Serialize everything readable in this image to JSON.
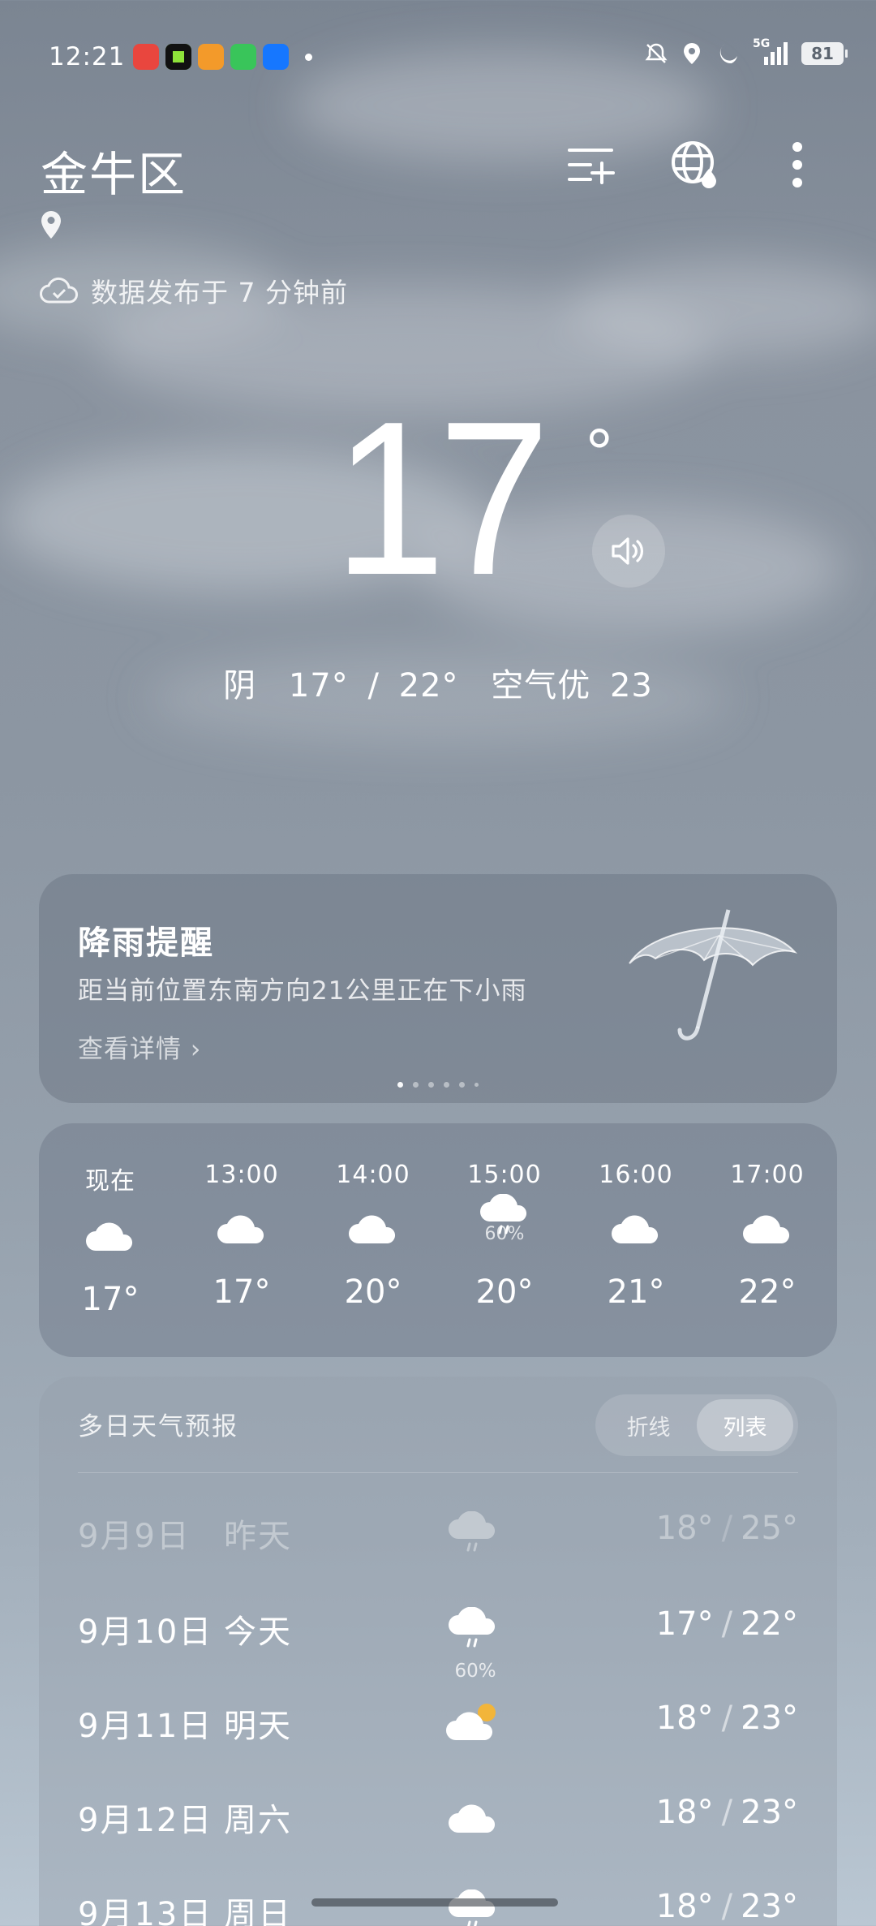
{
  "status_bar": {
    "time": "12:21",
    "network": "5G",
    "battery": "81"
  },
  "header": {
    "city": "金牛区",
    "updated": "数据发布于 7 分钟前"
  },
  "current": {
    "temperature": "17",
    "degree": "°",
    "condition": "阴",
    "range": "17° / 22°",
    "air": "空气优 23"
  },
  "rain_alert": {
    "title": "降雨提醒",
    "message": "距当前位置东南方向21公里正在下小雨",
    "link": "查看详情"
  },
  "hourly": [
    {
      "time": "现在",
      "icon": "cloud-icon",
      "temp": "17°",
      "precip": ""
    },
    {
      "time": "13:00",
      "icon": "cloud-icon",
      "temp": "17°",
      "precip": ""
    },
    {
      "time": "14:00",
      "icon": "cloud-icon",
      "temp": "20°",
      "precip": ""
    },
    {
      "time": "15:00",
      "icon": "rain-cloud-icon",
      "temp": "20°",
      "precip": "60%"
    },
    {
      "time": "16:00",
      "icon": "cloud-icon",
      "temp": "21°",
      "precip": ""
    },
    {
      "time": "17:00",
      "icon": "cloud-icon",
      "temp": "22°",
      "precip": ""
    }
  ],
  "daily": {
    "title": "多日天气预报",
    "toggle": {
      "line": "折线",
      "list": "列表"
    },
    "rows": [
      {
        "date": "9月9日",
        "weekday": "昨天",
        "icon": "rain-cloud-icon",
        "precip": "",
        "low": "18°",
        "high": "25°"
      },
      {
        "date": "9月10日",
        "weekday": "今天",
        "icon": "rain-cloud-icon",
        "precip": "60%",
        "low": "17°",
        "high": "22°"
      },
      {
        "date": "9月11日",
        "weekday": "明天",
        "icon": "partly-cloudy-icon",
        "precip": "",
        "low": "18°",
        "high": "23°"
      },
      {
        "date": "9月12日",
        "weekday": "周六",
        "icon": "cloud-icon",
        "precip": "",
        "low": "18°",
        "high": "23°"
      },
      {
        "date": "9月13日",
        "weekday": "周日",
        "icon": "rain-cloud-icon",
        "precip": "",
        "low": "18°",
        "high": "23°"
      }
    ]
  },
  "colors": {
    "sun": "#f2b53a",
    "card": "#6e7887"
  }
}
